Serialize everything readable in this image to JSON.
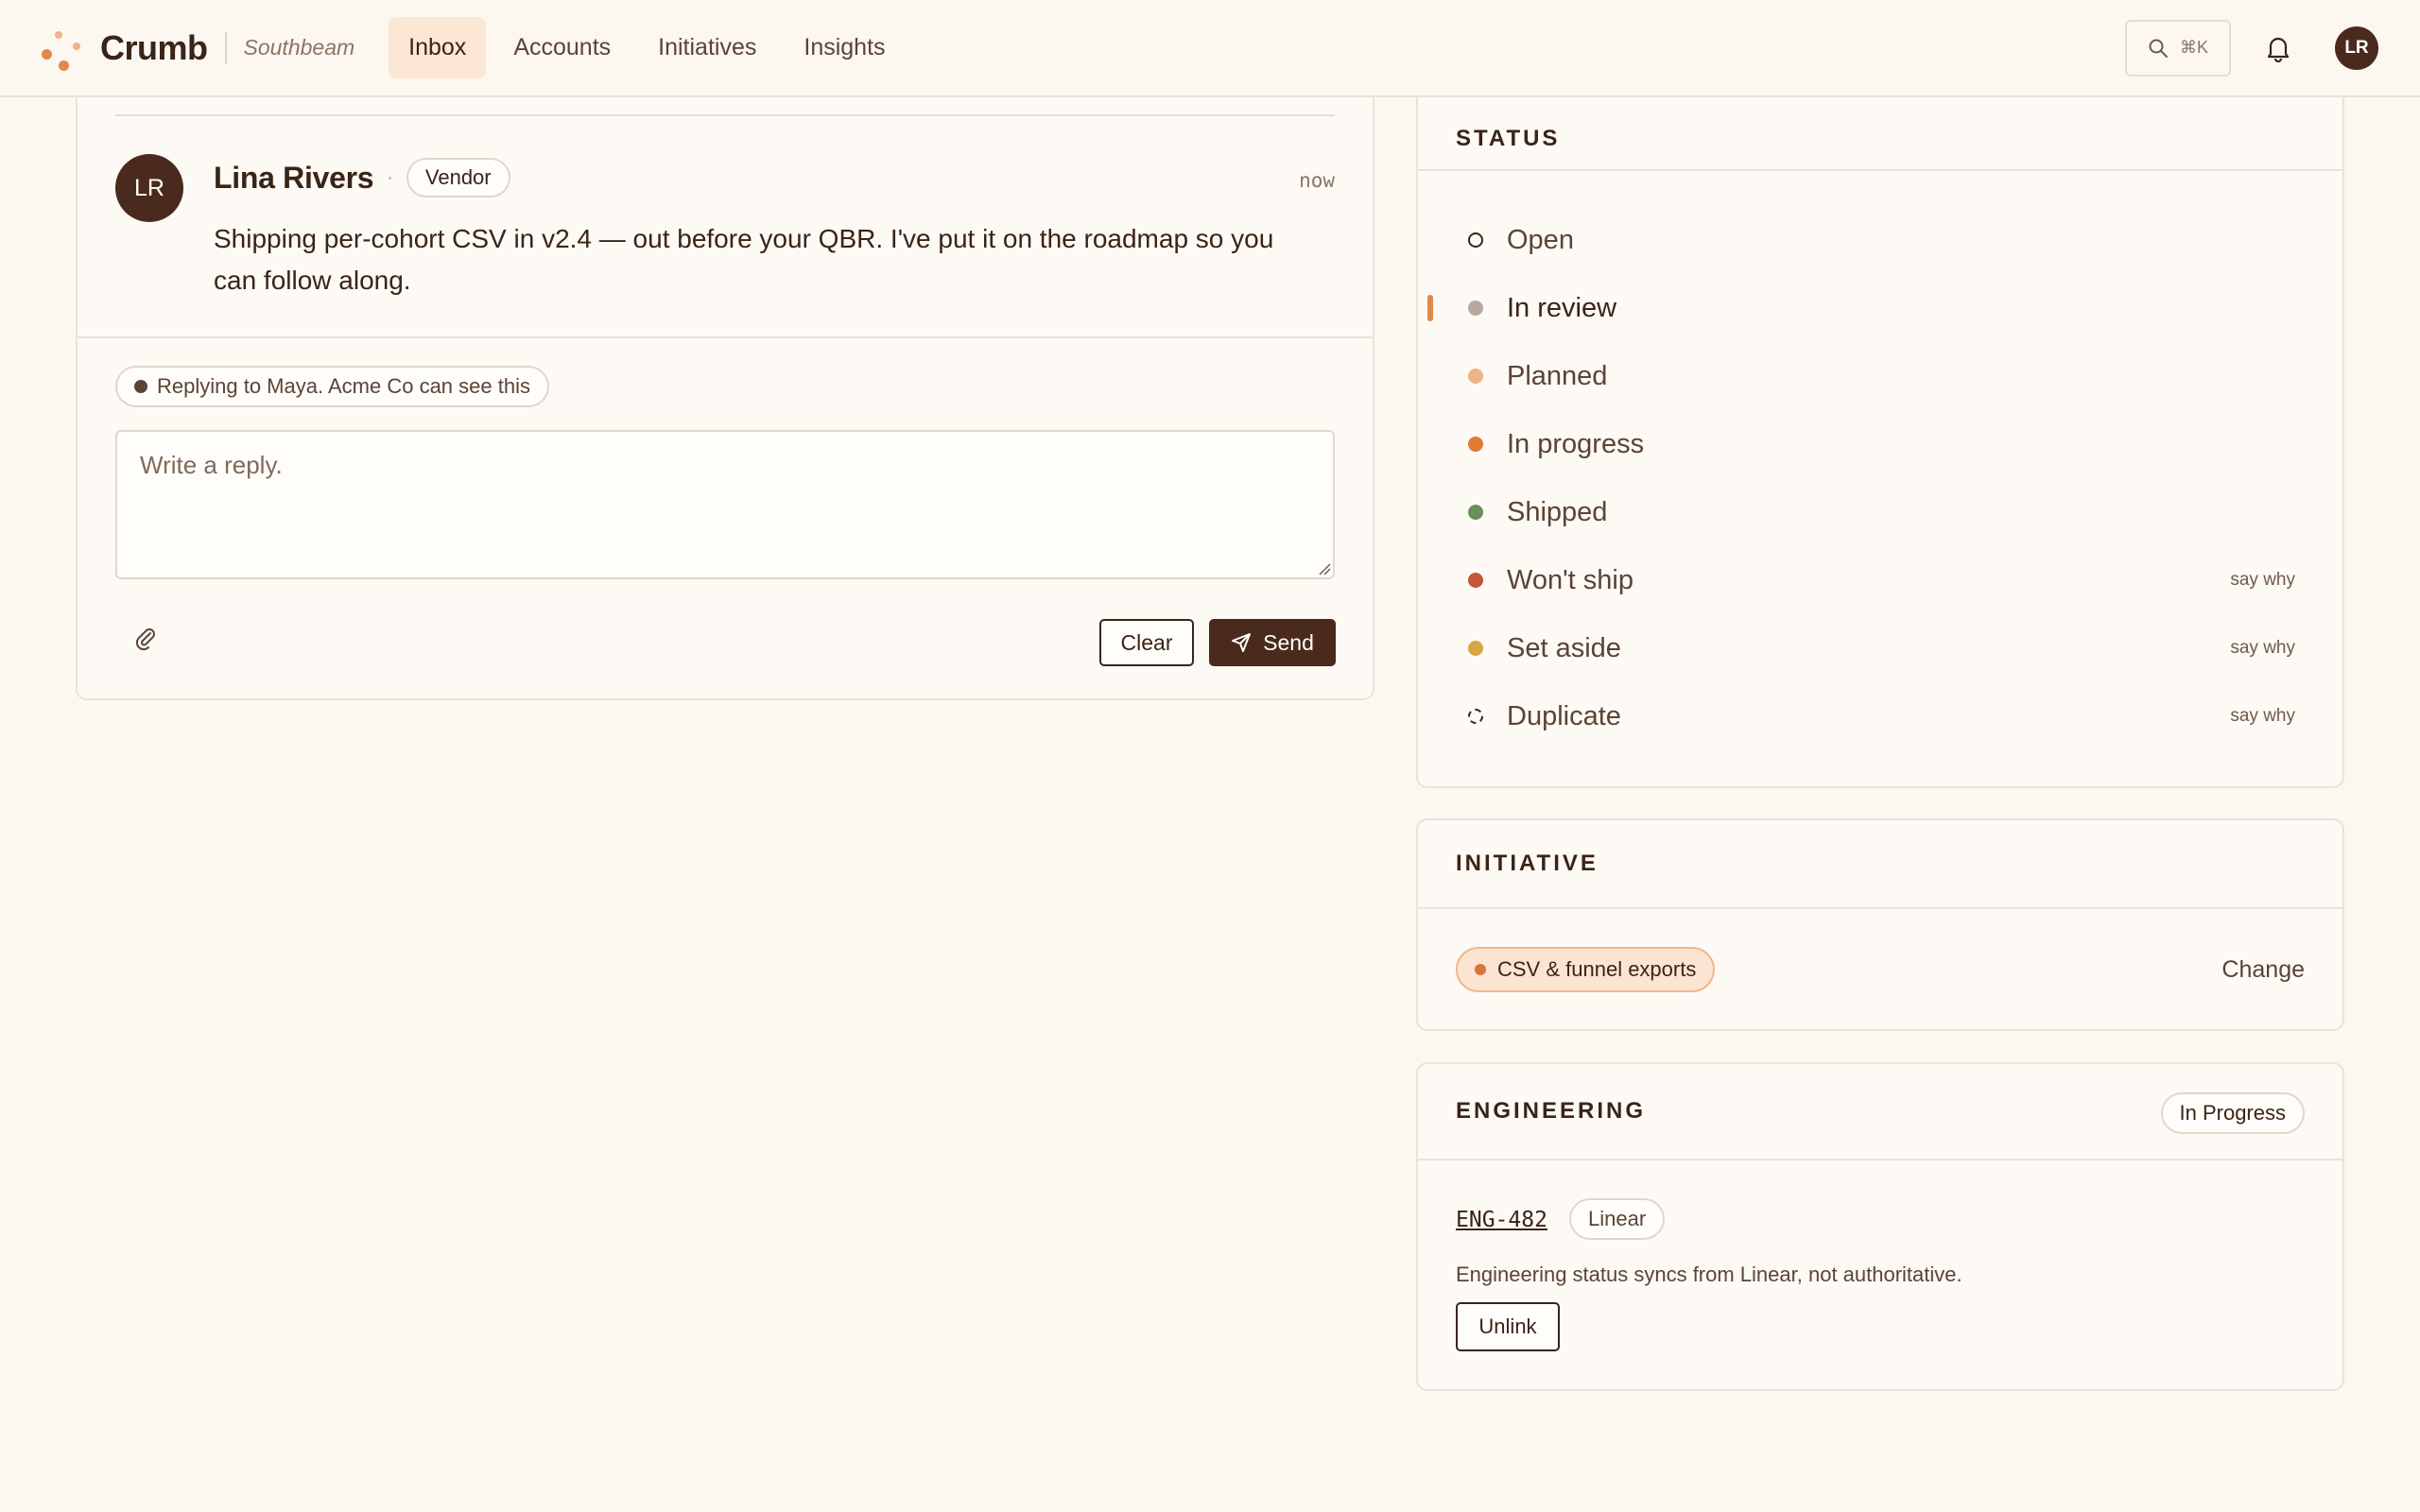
{
  "app": {
    "name": "Crumb",
    "workspace": "Southbeam",
    "user_initials": "LR",
    "search_shortcut": "⌘K"
  },
  "nav": [
    {
      "label": "Inbox",
      "active": true
    },
    {
      "label": "Accounts",
      "active": false
    },
    {
      "label": "Initiatives",
      "active": false
    },
    {
      "label": "Insights",
      "active": false
    }
  ],
  "thread": {
    "message": {
      "avatar_initials": "LR",
      "author": "Lina Rivers",
      "role": "Vendor",
      "time": "now",
      "body": "Shipping per-cohort CSV in v2.4 — out before your QBR. I've put it on the roadmap so you can follow along."
    },
    "compose": {
      "reply_context": "Replying to Maya. Acme Co can see this",
      "placeholder": "Write a reply.",
      "clear_label": "Clear",
      "send_label": "Send"
    }
  },
  "status_panel": {
    "title": "STATUS",
    "items": [
      {
        "label": "Open",
        "hint": "",
        "color": "#3a2417",
        "style": "ring"
      },
      {
        "label": "In review",
        "hint": "",
        "color": "#b5a89d",
        "style": "solid",
        "active": true
      },
      {
        "label": "Planned",
        "hint": "",
        "color": "#f0b287",
        "style": "solid"
      },
      {
        "label": "In progress",
        "hint": "",
        "color": "#e07a35",
        "style": "solid"
      },
      {
        "label": "Shipped",
        "hint": "",
        "color": "#6b8f5a",
        "style": "solid"
      },
      {
        "label": "Won't ship",
        "hint": "say why",
        "color": "#c2553a",
        "style": "solid"
      },
      {
        "label": "Set aside",
        "hint": "say why",
        "color": "#d9a640",
        "style": "solid"
      },
      {
        "label": "Duplicate",
        "hint": "say why",
        "color": "#3a2417",
        "style": "dashed"
      }
    ]
  },
  "initiative_panel": {
    "title": "INITIATIVE",
    "chip_label": "CSV & funnel exports",
    "change_label": "Change"
  },
  "engineering_panel": {
    "title": "ENGINEERING",
    "badge": "In Progress",
    "issue_id": "ENG-482",
    "source": "Linear",
    "note": "Engineering status syncs from Linear, not authoritative.",
    "unlink_label": "Unlink"
  }
}
